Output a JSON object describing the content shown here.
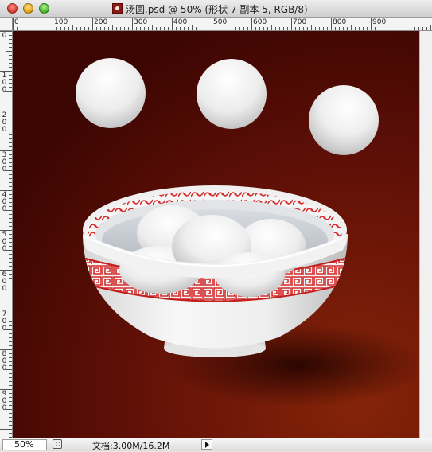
{
  "window": {
    "title": "汤圆.psd @ 50% (形状 7 副本 5, RGB/8)"
  },
  "ruler": {
    "horizontal_labels": [
      "0",
      "100",
      "200",
      "300",
      "400",
      "500",
      "600",
      "700",
      "800",
      "900"
    ],
    "vertical_labels": [
      "0",
      "100",
      "200",
      "300",
      "400",
      "500",
      "600",
      "700",
      "800",
      "900"
    ]
  },
  "status": {
    "zoom": "50%",
    "docinfo": "文档:3.00M/16.2M"
  },
  "colors": {
    "background_dark": "#3d0502",
    "background_light": "#7e2008",
    "bowl_pattern": "#d42a2a"
  }
}
